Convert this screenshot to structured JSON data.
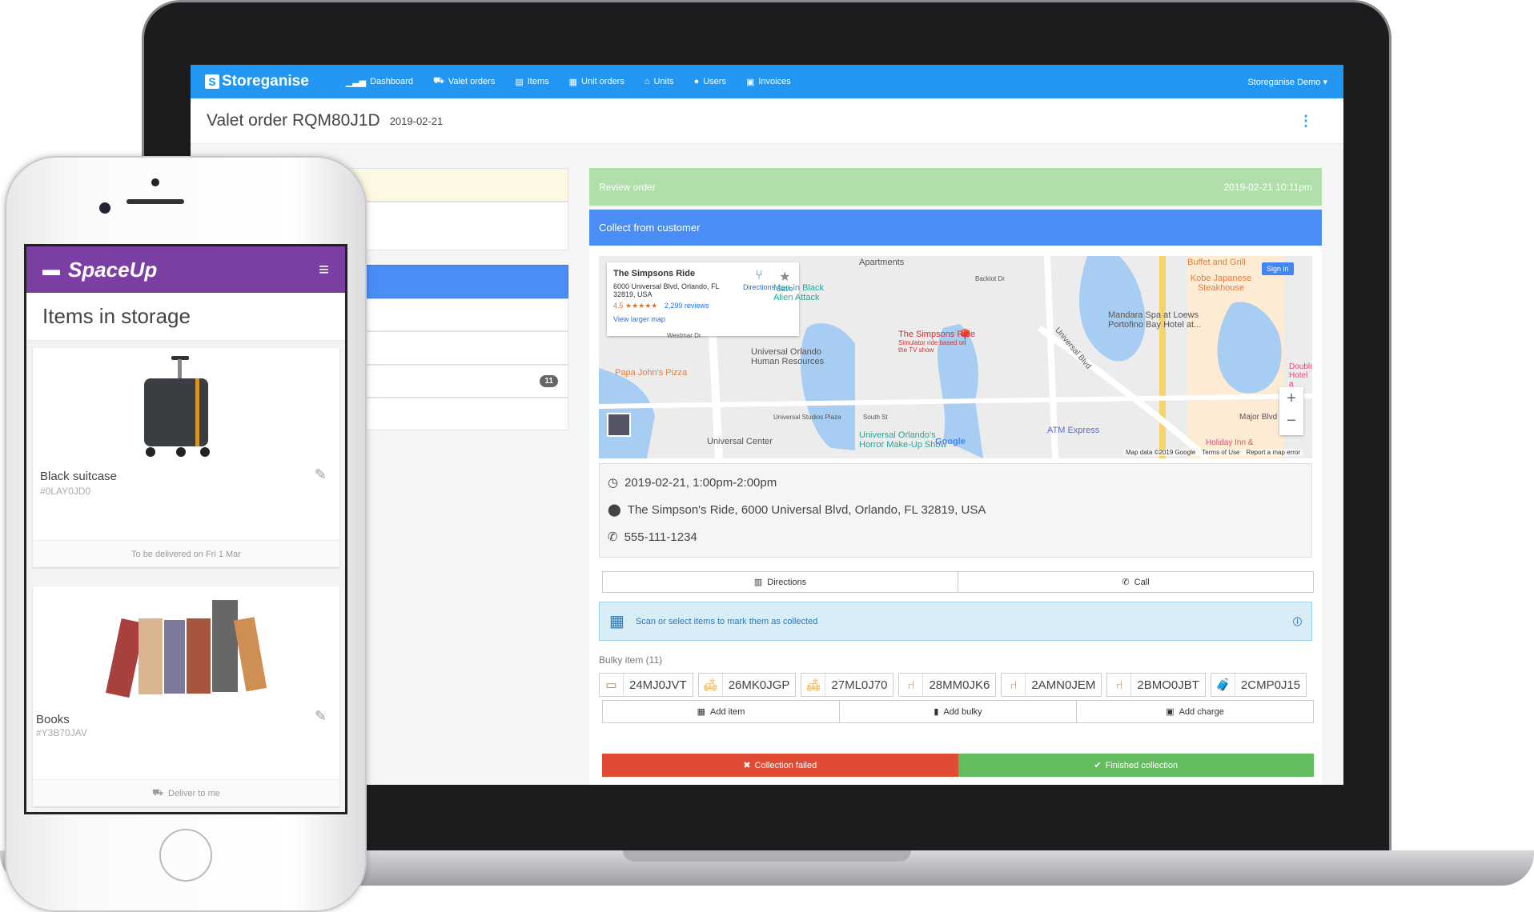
{
  "colors": {
    "nav": "#2196f3",
    "review": "#b0dfaa",
    "collect": "#4a8ef5",
    "failed": "#e04b34",
    "finished": "#62bd5e",
    "phone_header": "#7b3fa4"
  },
  "nav": {
    "brand": "Storeganise",
    "items": [
      {
        "icon": "bar-chart-icon",
        "label": "Dashboard"
      },
      {
        "icon": "truck-icon",
        "label": "Valet orders"
      },
      {
        "icon": "box-icon",
        "label": "Items"
      },
      {
        "icon": "list-icon",
        "label": "Unit orders"
      },
      {
        "icon": "building-icon",
        "label": "Units"
      },
      {
        "icon": "user-icon",
        "label": "Users"
      },
      {
        "icon": "money-icon",
        "label": "Invoices"
      }
    ],
    "account": "Storeganise Demo ▾"
  },
  "header": {
    "title": "Valet order RQM80J1D",
    "date": "2019-02-21"
  },
  "left": {
    "badge": "11"
  },
  "review": {
    "label": "Review order",
    "timestamp": "2019-02-21 10:11pm"
  },
  "collect": {
    "label": "Collect from customer"
  },
  "map": {
    "place": "The Simpsons Ride",
    "address": "6000 Universal Blvd, Orlando, FL 32819, USA",
    "rating": "4.5 ★★★★★",
    "reviews": "2,299 reviews",
    "larger": "View larger map",
    "directions": "Directions",
    "save": "Save",
    "signin": "Sign in",
    "pin_title": "The Simpsons Ride",
    "pin_sub": "Simulator ride based on the TV show",
    "labels": [
      "Men in Black Alien Attack",
      "Universal Orlando Human Resources",
      "Papa John's Pizza",
      "Mandara Spa at Loews Portofino Bay Hotel at...",
      "Kobe Japanese Steakhouse",
      "Buffet and Grill",
      "Universal Center",
      "Universal Orlando's Horror Make-Up Show",
      "ATM Express",
      "Major Blvd",
      "Universal Blvd",
      "Backlot Dr",
      "Westmar Dr",
      "Universal Studios Plaza",
      "South St",
      "Holiday Inn &",
      "Double Hotel a",
      "Apartments"
    ],
    "attribution": "Map data ©2019 Google",
    "terms": "Terms of Use",
    "report": "Report a map error",
    "google": "Google"
  },
  "details": {
    "time": "2019-02-21, 1:00pm-2:00pm",
    "address": "The Simpson's Ride, 6000 Universal Blvd, Orlando, FL 32819, USA",
    "phone": "555-111-1234"
  },
  "actions": {
    "directions": "Directions",
    "call": "Call"
  },
  "scan": {
    "text": "Scan or select items to mark them as collected"
  },
  "bulky": {
    "label": "Bulky item (11)",
    "items": [
      {
        "code": "24MJ0JVT",
        "thumb": "mattress"
      },
      {
        "code": "26MK0JGP",
        "thumb": "sofa"
      },
      {
        "code": "27ML0J70",
        "thumb": "sofa"
      },
      {
        "code": "28MM0JK6",
        "thumb": "chair"
      },
      {
        "code": "2AMN0JEM",
        "thumb": "chair"
      },
      {
        "code": "2BMO0JBT",
        "thumb": "chair"
      },
      {
        "code": "2CMP0J15",
        "thumb": "luggage"
      }
    ]
  },
  "add": {
    "item": "Add item",
    "bulky": "Add bulky",
    "charge": "Add charge"
  },
  "final": {
    "failed": "Collection failed",
    "finished": "Finished collection"
  },
  "phone": {
    "brand": "SpaceUp",
    "title": "Items in storage",
    "cards": [
      {
        "name": "Black suitcase",
        "id": "#0LAY0JD0",
        "footer": "To be delivered on Fri 1 Mar"
      },
      {
        "name": "Books",
        "id": "#Y3B70JAV",
        "footer": "Deliver to me"
      }
    ]
  }
}
